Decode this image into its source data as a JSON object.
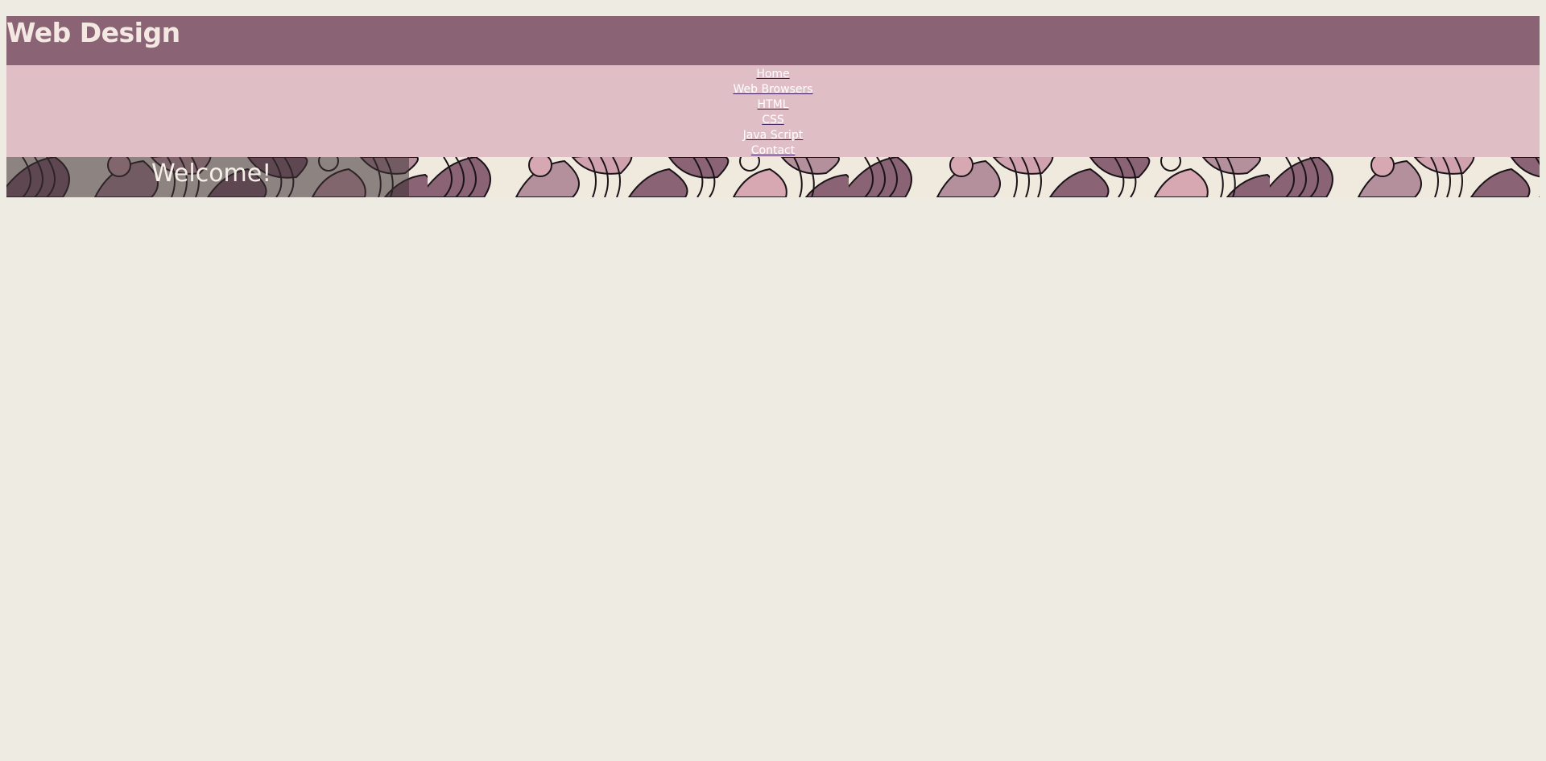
{
  "header": {
    "title": "Web Design"
  },
  "nav": {
    "items": [
      {
        "label": "Home"
      },
      {
        "label": "Web Browsers"
      },
      {
        "label": "HTML"
      },
      {
        "label": "CSS"
      },
      {
        "label": "Java Script"
      },
      {
        "label": "Contact"
      }
    ]
  },
  "banner": {
    "welcome": "Welcome!"
  },
  "colors": {
    "background": "#eeebe3",
    "header": "#8a6374",
    "nav": "#e0bec6",
    "title_text": "#f3e8e2"
  }
}
